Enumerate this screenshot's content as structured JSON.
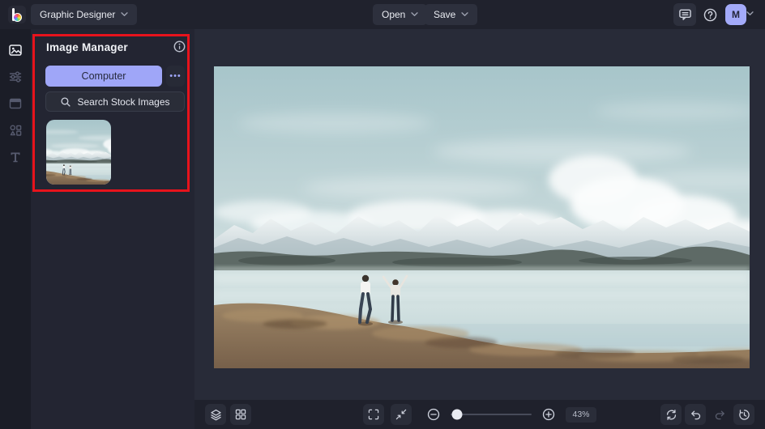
{
  "header": {
    "mode_label": "Graphic Designer",
    "open_label": "Open",
    "save_label": "Save",
    "avatar_initial": "M"
  },
  "sidebar": {
    "items": [
      "image-manager",
      "edit",
      "templates",
      "graphics",
      "text"
    ]
  },
  "image_manager": {
    "title": "Image Manager",
    "computer_button": "Computer",
    "more_button": "•••",
    "search_button": "Search Stock Images"
  },
  "canvas": {
    "image_alt": "Two people standing on a dry grassy lakeshore with a calm lake, snow-capped mountains and a cloudy blue-grey sky"
  },
  "footer": {
    "zoom_percent": "43%"
  },
  "colors": {
    "accent": "#9fa6f8",
    "annotation_red": "#e7131c"
  }
}
